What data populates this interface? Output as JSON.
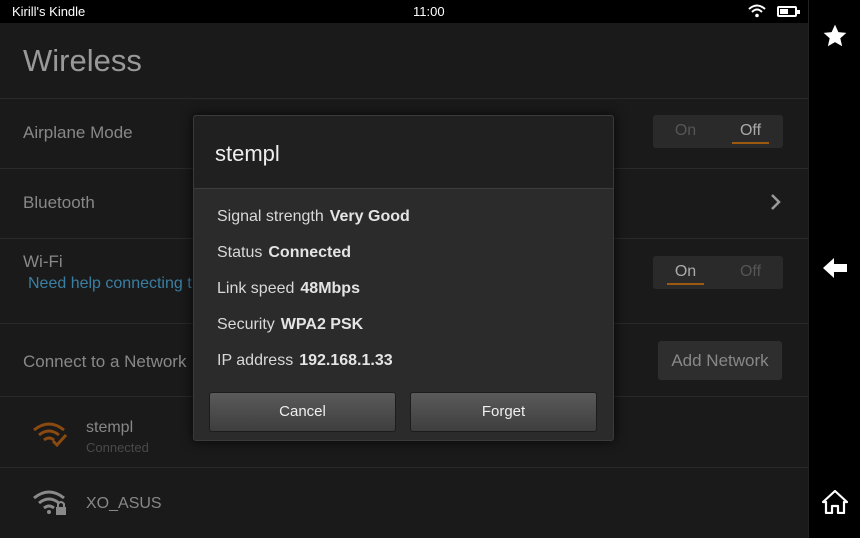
{
  "status_bar": {
    "device_name": "Kirill's Kindle",
    "time": "11:00"
  },
  "nav": {
    "favorites_icon": "star-icon",
    "back_icon": "back-arrow-icon",
    "home_icon": "home-icon"
  },
  "page": {
    "title": "Wireless",
    "airplane_mode": {
      "label": "Airplane Mode",
      "on_label": "On",
      "off_label": "Off",
      "selected": "Off"
    },
    "bluetooth": {
      "label": "Bluetooth"
    },
    "wifi": {
      "label": "Wi-Fi",
      "help_link": "Need help connecting t",
      "on_label": "On",
      "off_label": "Off",
      "selected": "On"
    },
    "connect_section": {
      "label": "Connect to a Network",
      "add_button": "Add Network"
    },
    "networks": [
      {
        "name": "stempl",
        "status": "Connected",
        "secured": false,
        "color": "#8a4a10"
      },
      {
        "name": "XO_ASUS",
        "status": "",
        "secured": true,
        "color": "#8a8a8a"
      }
    ]
  },
  "dialog": {
    "title": "stempl",
    "rows": [
      {
        "label": "Signal strength",
        "value": "Very Good"
      },
      {
        "label": "Status",
        "value": "Connected"
      },
      {
        "label": "Link speed",
        "value": "48Mbps"
      },
      {
        "label": "Security",
        "value": "WPA2 PSK"
      },
      {
        "label": "IP address",
        "value": "192.168.1.33"
      }
    ],
    "cancel_label": "Cancel",
    "forget_label": "Forget"
  },
  "colors": {
    "accent": "#9b5a10",
    "link": "#3a7fa3"
  }
}
